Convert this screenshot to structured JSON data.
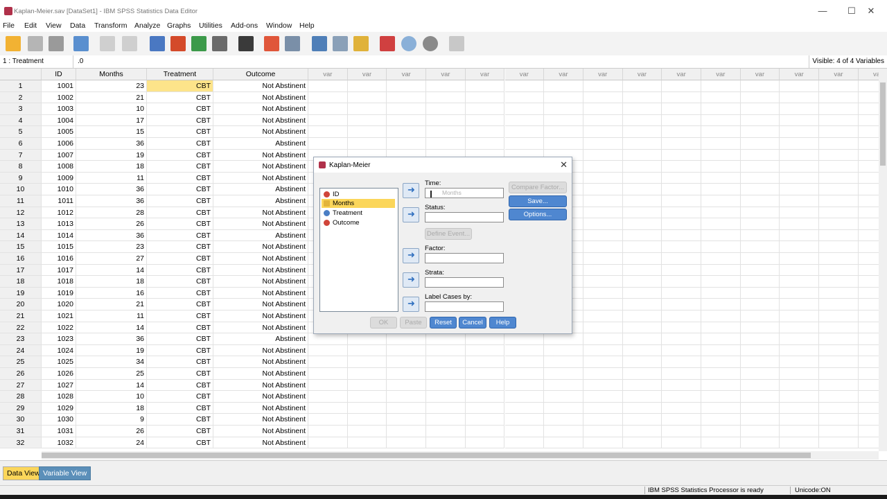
{
  "window": {
    "title": "Kaplan-Meier.sav [DataSet1] - IBM SPSS Statistics Data Editor",
    "minimize": "—",
    "maximize": "☐",
    "close": "✕"
  },
  "menu": [
    "File",
    "Edit",
    "View",
    "Data",
    "Transform",
    "Analyze",
    "Graphs",
    "Utilities",
    "Add-ons",
    "Window",
    "Help"
  ],
  "cell_editor": {
    "ref": "1 : Treatment",
    "value": ".0",
    "visible": "Visible: 4 of 4 Variables"
  },
  "columns": [
    "ID",
    "Months",
    "Treatment",
    "Outcome"
  ],
  "var_label": "var",
  "rows": [
    [
      "1",
      "1001",
      "23",
      "CBT",
      "Not Abstinent"
    ],
    [
      "2",
      "1002",
      "21",
      "CBT",
      "Not Abstinent"
    ],
    [
      "3",
      "1003",
      "10",
      "CBT",
      "Not Abstinent"
    ],
    [
      "4",
      "1004",
      "17",
      "CBT",
      "Not Abstinent"
    ],
    [
      "5",
      "1005",
      "15",
      "CBT",
      "Not Abstinent"
    ],
    [
      "6",
      "1006",
      "36",
      "CBT",
      "Abstinent"
    ],
    [
      "7",
      "1007",
      "19",
      "CBT",
      "Not Abstinent"
    ],
    [
      "8",
      "1008",
      "18",
      "CBT",
      "Not Abstinent"
    ],
    [
      "9",
      "1009",
      "11",
      "CBT",
      "Not Abstinent"
    ],
    [
      "10",
      "1010",
      "36",
      "CBT",
      "Abstinent"
    ],
    [
      "11",
      "1011",
      "36",
      "CBT",
      "Abstinent"
    ],
    [
      "12",
      "1012",
      "28",
      "CBT",
      "Not Abstinent"
    ],
    [
      "13",
      "1013",
      "26",
      "CBT",
      "Not Abstinent"
    ],
    [
      "14",
      "1014",
      "36",
      "CBT",
      "Abstinent"
    ],
    [
      "15",
      "1015",
      "23",
      "CBT",
      "Not Abstinent"
    ],
    [
      "16",
      "1016",
      "27",
      "CBT",
      "Not Abstinent"
    ],
    [
      "17",
      "1017",
      "14",
      "CBT",
      "Not Abstinent"
    ],
    [
      "18",
      "1018",
      "18",
      "CBT",
      "Not Abstinent"
    ],
    [
      "19",
      "1019",
      "16",
      "CBT",
      "Not Abstinent"
    ],
    [
      "20",
      "1020",
      "21",
      "CBT",
      "Not Abstinent"
    ],
    [
      "21",
      "1021",
      "11",
      "CBT",
      "Not Abstinent"
    ],
    [
      "22",
      "1022",
      "14",
      "CBT",
      "Not Abstinent"
    ],
    [
      "23",
      "1023",
      "36",
      "CBT",
      "Abstinent"
    ],
    [
      "24",
      "1024",
      "19",
      "CBT",
      "Not Abstinent"
    ],
    [
      "25",
      "1025",
      "34",
      "CBT",
      "Not Abstinent"
    ],
    [
      "26",
      "1026",
      "25",
      "CBT",
      "Not Abstinent"
    ],
    [
      "27",
      "1027",
      "14",
      "CBT",
      "Not Abstinent"
    ],
    [
      "28",
      "1028",
      "10",
      "CBT",
      "Not Abstinent"
    ],
    [
      "29",
      "1029",
      "18",
      "CBT",
      "Not Abstinent"
    ],
    [
      "30",
      "1030",
      "9",
      "CBT",
      "Not Abstinent"
    ],
    [
      "31",
      "1031",
      "26",
      "CBT",
      "Not Abstinent"
    ],
    [
      "32",
      "1032",
      "24",
      "CBT",
      "Not Abstinent"
    ]
  ],
  "tabs": {
    "data_view": "Data View",
    "variable_view": "Variable View"
  },
  "status": {
    "processor": "IBM SPSS Statistics Processor is ready",
    "unicode": "Unicode:ON"
  },
  "dialog": {
    "title": "Kaplan-Meier",
    "variables": [
      "ID",
      "Months",
      "Treatment",
      "Outcome"
    ],
    "time_label": "Time:",
    "time_drag": "Months",
    "status_label": "Status:",
    "define_event": "Define Event...",
    "factor_label": "Factor:",
    "strata_label": "Strata:",
    "label_cases_label": "Label Cases by:",
    "compare_factor": "Compare Factor...",
    "save": "Save...",
    "options": "Options...",
    "ok": "OK",
    "paste": "Paste",
    "reset": "Reset",
    "cancel": "Cancel",
    "help": "Help"
  },
  "colors": {
    "selected_cell": "#fde48a",
    "data_view_tab": "#fbd65a",
    "variable_view_tab": "#5b8fb9",
    "dialog_button": "#4f87d0"
  }
}
